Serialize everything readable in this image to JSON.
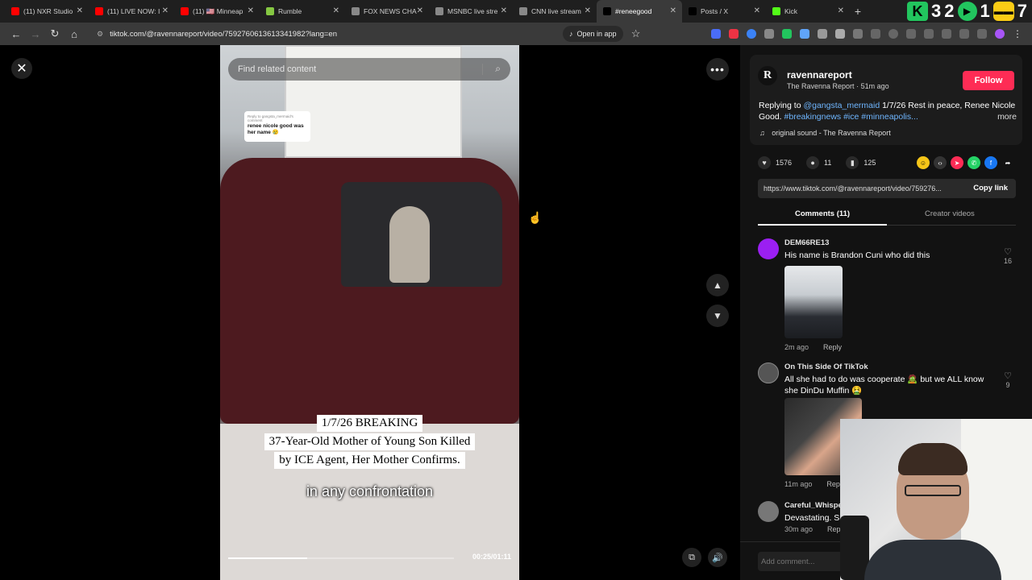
{
  "browser": {
    "tabs": [
      {
        "label": "(11) NXR Studio",
        "favicon_color": "#ff0000"
      },
      {
        "label": "(11) LIVE NOW: I",
        "favicon_color": "#ff0000"
      },
      {
        "label": "(11) 🇺🇸 Minneap",
        "favicon_color": "#ff0000"
      },
      {
        "label": "Rumble",
        "favicon_color": "#85c742"
      },
      {
        "label": "FOX NEWS CHA",
        "favicon_color": "#888888"
      },
      {
        "label": "MSNBC live stre",
        "favicon_color": "#888888"
      },
      {
        "label": "CNN live stream",
        "favicon_color": "#888888"
      },
      {
        "label": "#reneegood",
        "favicon_color": "#000000",
        "active": true
      },
      {
        "label": "Posts / X",
        "favicon_color": "#000000"
      },
      {
        "label": "Kick",
        "favicon_color": "#53fc18"
      }
    ],
    "new_tab": "+",
    "overlay_numbers": [
      "3",
      "2",
      "1",
      "7"
    ],
    "url": "tiktok.com/@ravennareport/video/7592760613613341982?lang=en",
    "open_in_app": "Open in app"
  },
  "video": {
    "search_placeholder": "Find related content",
    "sticker_top": "Reply to gangsta_mermaid's comment",
    "sticker_text": "renee nicole good was her name 😢",
    "captions": [
      "1/7/26 BREAKING",
      "37-Year-Old Mother of Young Son Killed",
      "by ICE Agent, Her Mother Confirms."
    ],
    "subtitle": "in any confrontation",
    "timecode": "00:25/01:11",
    "progress": 0.35
  },
  "creator": {
    "avatar_letter": "R",
    "username": "ravennareport",
    "display_name": "The Ravenna Report",
    "posted": "51m ago",
    "follow_label": "Follow",
    "desc_prefix": "Replying to ",
    "desc_mention": "@gangsta_mermaid",
    "desc_text": " 1/7/26 Rest in peace, Renee Nicole Good. ",
    "desc_tags": "#breakingnews #ice #minneapolis...",
    "desc_more": "more",
    "sound": "original sound - The Ravenna Report"
  },
  "stats": {
    "likes": "1576",
    "comments": "11",
    "saves": "125"
  },
  "link": {
    "url": "https://www.tiktok.com/@ravennareport/video/759276...",
    "copy_label": "Copy link"
  },
  "tabs": {
    "comments": "Comments (11)",
    "creator_videos": "Creator videos"
  },
  "comments": [
    {
      "name": "DEM66RE13",
      "text": "His name is Brandon Cuni who did this",
      "time": "2m ago",
      "reply": "Reply",
      "likes": "16",
      "avatar_color": "#9b1ff2"
    },
    {
      "name": "On This Side Of TikTok",
      "text": "All she had to do was cooperate 🧟 but we ALL know she DinDu Muffin 🤮",
      "time": "11m ago",
      "reply": "Reply",
      "likes": "9",
      "avatar_color": "#555555"
    },
    {
      "name": "Careful_Whisper",
      "text": "Devastating. S",
      "time": "30m ago",
      "reply": "Reply",
      "likes": "",
      "avatar_color": "#777777"
    }
  ],
  "add_comment": "Add comment..."
}
